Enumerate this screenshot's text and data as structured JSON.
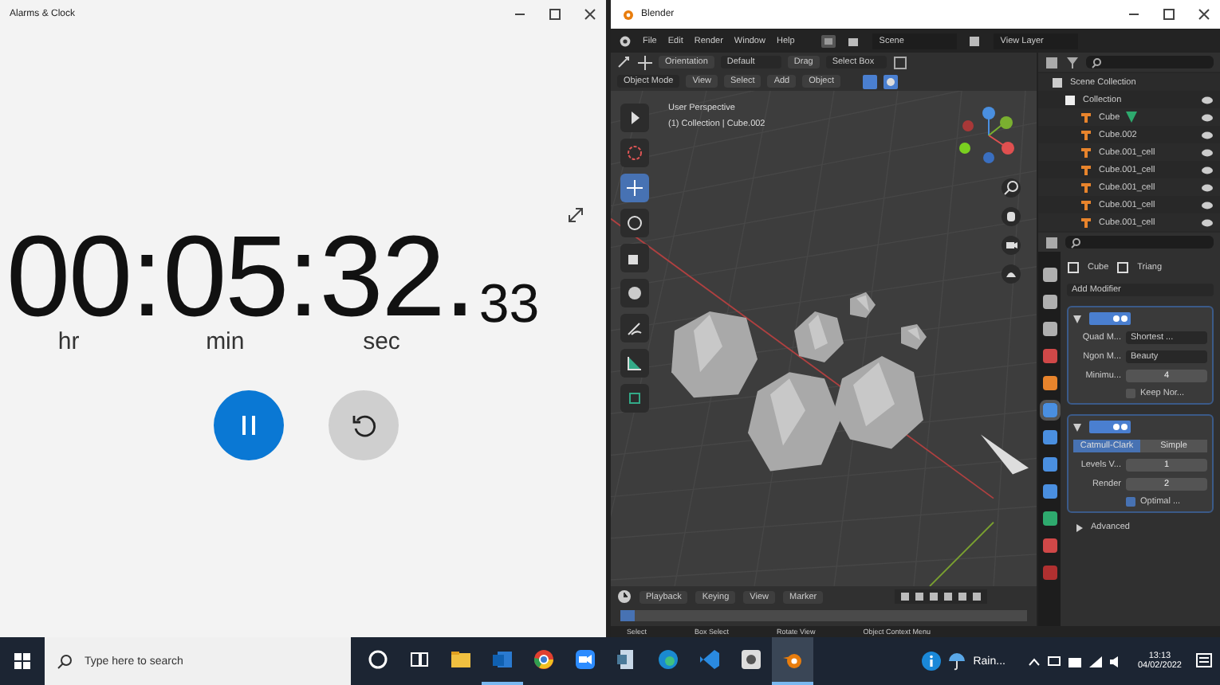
{
  "alarms_window": {
    "title": "Alarms & Clock",
    "stopwatch": {
      "parts": [
        {
          "value": "00",
          "unit": "hr"
        },
        {
          "value": "05",
          "unit": "min"
        },
        {
          "value": "32",
          "unit": "sec"
        }
      ],
      "separators": [
        ":",
        ":",
        "."
      ],
      "fraction": "33",
      "running": true
    }
  },
  "blender_window": {
    "title": "Blender",
    "menu": [
      "File",
      "Edit",
      "Render",
      "Window",
      "Help"
    ],
    "scene": "Scene",
    "view_layer": "View Layer",
    "header": {
      "orientation": "Orientation",
      "pivot": "Default",
      "drag": "Drag",
      "select": "Select Box"
    },
    "mode": "Object Mode",
    "viewport_menu": [
      "View",
      "Select",
      "Add",
      "Object"
    ],
    "viewport": {
      "perspective": "User Perspective",
      "context": "(1) Collection | Cube.002"
    },
    "tools": [
      {
        "kind": "tweak",
        "selected": false
      },
      {
        "kind": "cursor",
        "selected": false
      },
      {
        "kind": "move",
        "selected": true
      },
      {
        "kind": "rotate",
        "selected": false
      },
      {
        "kind": "scale",
        "selected": false
      },
      {
        "kind": "transform",
        "selected": false
      },
      {
        "kind": "annotate",
        "selected": false
      },
      {
        "kind": "measure",
        "selected": false
      },
      {
        "kind": "add-cube",
        "selected": false
      }
    ],
    "outliner": {
      "root": "Scene Collection",
      "collection": "Collection",
      "objects": [
        {
          "name": "Cube",
          "modifier_icon": true
        },
        {
          "name": "Cube.002",
          "modifier_icon": false
        },
        {
          "name": "Cube.001_cell",
          "modifier_icon": false
        },
        {
          "name": "Cube.001_cell",
          "modifier_icon": false
        },
        {
          "name": "Cube.001_cell",
          "modifier_icon": false
        },
        {
          "name": "Cube.001_cell",
          "modifier_icon": false
        },
        {
          "name": "Cube.001_cell",
          "modifier_icon": false
        }
      ]
    },
    "properties": {
      "object": "Cube",
      "modifier": "Triang",
      "add_modifier": "Add Modifier",
      "tabs": [
        {
          "color": "#b0b0b0",
          "selected": false
        },
        {
          "color": "#b0b0b0",
          "selected": false
        },
        {
          "color": "#b0b0b0",
          "selected": false
        },
        {
          "color": "#d04848",
          "selected": false
        },
        {
          "color": "#e8842c",
          "selected": false
        },
        {
          "color": "#4a8fe0",
          "selected": true
        },
        {
          "color": "#4a8fe0",
          "selected": false
        },
        {
          "color": "#4a8fe0",
          "selected": false
        },
        {
          "color": "#4a8fe0",
          "selected": false
        },
        {
          "color": "#2eaa6e",
          "selected": false
        },
        {
          "color": "#d04848",
          "selected": false
        },
        {
          "color": "#b03030",
          "selected": false
        }
      ],
      "modifiers": [
        {
          "rows": [
            {
              "kind": "dropdown",
              "label": "Quad M...",
              "value": "Shortest ..."
            },
            {
              "kind": "dropdown",
              "label": "Ngon M...",
              "value": "Beauty"
            },
            {
              "kind": "number",
              "label": "Minimu...",
              "value": "4"
            },
            {
              "kind": "checkbox",
              "label": "Keep Nor...",
              "checked": false
            }
          ]
        },
        {
          "options": [
            {
              "label": "Catmull-Clark",
              "selected": true
            },
            {
              "label": "Simple",
              "selected": false
            }
          ],
          "rows": [
            {
              "kind": "number",
              "label": "Levels V...",
              "value": "1"
            },
            {
              "kind": "number",
              "label": "Render",
              "value": "2"
            },
            {
              "kind": "checkbox",
              "label": "Optimal ...",
              "checked": true
            }
          ]
        }
      ],
      "advanced": "Advanced"
    },
    "timeline": {
      "menu": [
        "Playback",
        "Keying",
        "View",
        "Marker"
      ]
    },
    "status_bar": [
      "Select",
      "Box Select",
      "Rotate View",
      "Object Context Menu"
    ]
  },
  "taskbar": {
    "search_placeholder": "Type here to search",
    "apps": [
      {
        "kind": "cortana",
        "active": false
      },
      {
        "kind": "taskview",
        "active": false
      },
      {
        "kind": "folder",
        "active": false
      },
      {
        "kind": "mail",
        "active": true
      },
      {
        "kind": "browser",
        "active": false
      },
      {
        "kind": "video",
        "active": false
      },
      {
        "kind": "document",
        "active": false
      },
      {
        "kind": "edge",
        "active": false
      },
      {
        "kind": "code",
        "active": false
      },
      {
        "kind": "app",
        "active": false
      },
      {
        "kind": "blender",
        "active": true
      }
    ],
    "weather": "Rain...",
    "time": "13:13",
    "date": "04/02/2022"
  }
}
